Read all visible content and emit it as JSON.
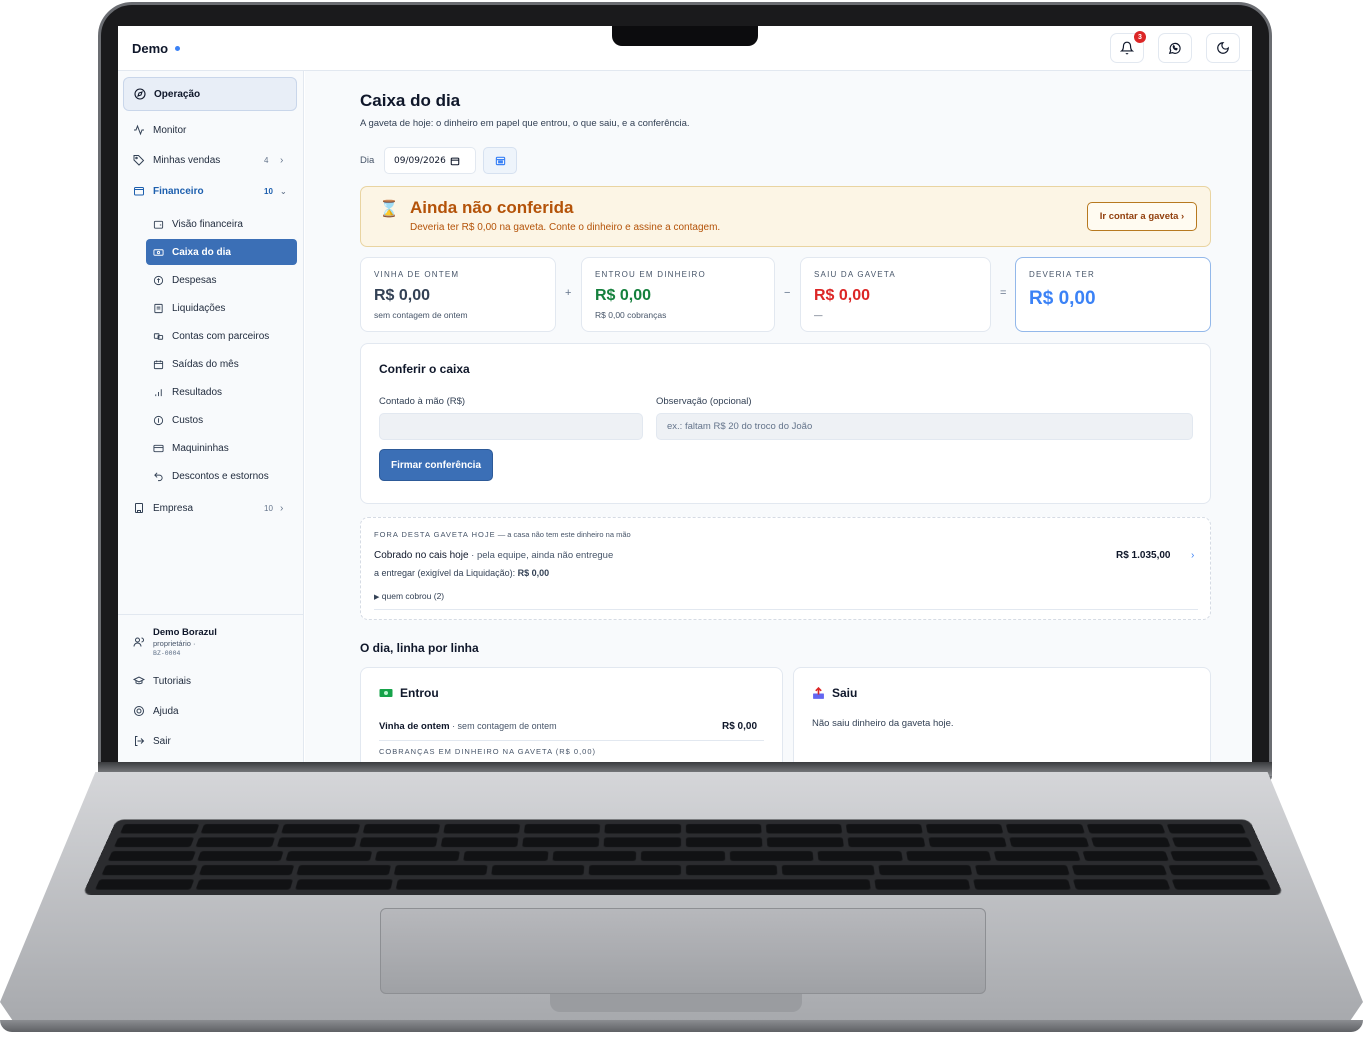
{
  "app": {
    "brand": "Demo"
  },
  "topbar": {
    "notifications_count": "3"
  },
  "sidebar": {
    "section_label": "Operação",
    "items": [
      {
        "label": "Monitor"
      },
      {
        "label": "Minhas vendas",
        "count": "4"
      },
      {
        "label": "Financeiro",
        "count": "10"
      }
    ],
    "financeiro_items": [
      {
        "label": "Visão financeira"
      },
      {
        "label": "Caixa do dia"
      },
      {
        "label": "Despesas"
      },
      {
        "label": "Liquidações"
      },
      {
        "label": "Contas com parceiros"
      },
      {
        "label": "Saídas do mês"
      },
      {
        "label": "Resultados"
      },
      {
        "label": "Custos"
      },
      {
        "label": "Maquininhas"
      },
      {
        "label": "Descontos e estornos"
      }
    ],
    "empresa": {
      "label": "Empresa",
      "count": "10"
    },
    "user": {
      "name": "Demo Borazul",
      "role": "proprietário ·",
      "code": "BZ-0004"
    },
    "footer": [
      {
        "label": "Tutoriais"
      },
      {
        "label": "Ajuda"
      },
      {
        "label": "Sair"
      }
    ]
  },
  "page": {
    "title": "Caixa do dia",
    "subtitle": "A gaveta de hoje: o dinheiro em papel que entrou, o que saiu, e a conferência.",
    "day_label": "Dia",
    "date_value": "09/09/2026"
  },
  "alert": {
    "title": "Ainda não conferida",
    "text": "Deveria ter R$ 0,00 na gaveta. Conte o dinheiro e assine a contagem.",
    "button": "Ir contar a gaveta ›"
  },
  "summary": [
    {
      "label": "VINHA DE ONTEM",
      "value": "R$ 0,00",
      "note": "sem contagem de ontem"
    },
    {
      "label": "ENTROU EM DINHEIRO",
      "value": "R$ 0,00",
      "note": "R$ 0,00 cobranças"
    },
    {
      "label": "SAIU DA GAVETA",
      "value": "R$ 0,00",
      "note": "—"
    },
    {
      "label": "DEVERIA TER",
      "value": "R$ 0,00"
    }
  ],
  "operators": {
    "plus": "+",
    "minus": "−",
    "equals": "="
  },
  "conferir": {
    "title": "Conferir o caixa",
    "counted_label": "Contado à mão (R$)",
    "counted_value": "",
    "note_label": "Observação (opcional)",
    "note_placeholder": "ex.: faltam R$ 20 do troco do João",
    "submit": "Firmar conferência"
  },
  "fora": {
    "header_caps": "FORA DESTA GAVETA HOJE",
    "header_rest": " — a casa não tem este dinheiro na mão",
    "row_title": "Cobrado no cais hoje",
    "row_desc": " · pela equipe, ainda não entregue",
    "row_amount": "R$ 1.035,00",
    "sub_label": "a entregar (exigível da Liquidação): ",
    "sub_value": "R$ 0,00",
    "details": "quem cobrou (2)"
  },
  "day_lines": {
    "title": "O dia, linha por linha",
    "in": {
      "title": "Entrou",
      "row_label": "Vinha de ontem",
      "row_desc": " · sem contagem de ontem",
      "row_amount": "R$ 0,00",
      "caps": "COBRANÇAS EM DINHEIRO NA GAVETA (R$ 0,00)"
    },
    "out": {
      "title": "Saiu",
      "empty": "Não saiu dinheiro da gaveta hoje."
    }
  },
  "colors": {
    "accent": "#3b6fb6",
    "positive": "#15803d",
    "negative": "#dc2626",
    "expected": "#3b82f6",
    "warning": "#b45309"
  }
}
